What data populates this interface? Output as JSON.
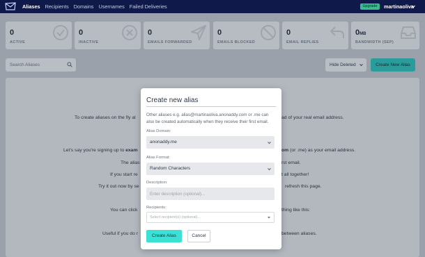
{
  "nav": {
    "links": [
      "Aliases",
      "Recipients",
      "Domains",
      "Usernames",
      "Failed Deliveries"
    ],
    "active_index": 0,
    "upgrade_label": "Upgrade",
    "username": "martinaoliva"
  },
  "stats": [
    {
      "value": "0",
      "unit": "",
      "label": "Active",
      "icon": "check-circle-icon"
    },
    {
      "value": "0",
      "unit": "",
      "label": "Inactive",
      "icon": "x-circle-icon"
    },
    {
      "value": "0",
      "unit": "",
      "label": "Emails Forwarded",
      "icon": "send-icon"
    },
    {
      "value": "0",
      "unit": "",
      "label": "Emails Blocked",
      "icon": "block-icon"
    },
    {
      "value": "0",
      "unit": "",
      "label": "Email Replies",
      "icon": "reply-icon"
    },
    {
      "value": "0",
      "unit": "MB",
      "label": "Bandwidth (Sep)",
      "icon": "inbox-icon"
    }
  ],
  "toolbar": {
    "search_placeholder": "Search Aliases",
    "hide_deleted_label": "Hide Deleted",
    "new_alias_label": "Create New Alias"
  },
  "background": {
    "line1_left": "To create aliases on the fly al",
    "line1_right": "ad of your real email address.",
    "line2_left": "Let's say you're signing up to ",
    "line2_left_bold": "exam",
    "line2_right_bold": "om",
    "line2_right": " (or .me) as your email address.",
    "line3_left": "The alias",
    "line3_right": "rst email.",
    "line4_left": "If you start re",
    "line4_right": "t all together!",
    "line5_left": "Try it out now by se",
    "line5_right": "refresh this page.",
    "line6_left": "You can click",
    "line6_right": "thing like this:",
    "line7_left": "Useful if you do r",
    "line7_right": "between aliases."
  },
  "modal": {
    "title": "Create new alias",
    "description": "Other aliases e.g. alias@martinaoliva.anonaddy.com or .me can also be created automatically when they receive their first email.",
    "domain_label": "Alias Domain:",
    "domain_value": "anonaddy.me",
    "format_label": "Alias Format:",
    "format_value": "Random Characters",
    "description_label": "Description:",
    "description_placeholder": "Enter description (optional)...",
    "recipients_label": "Recipients:",
    "recipients_placeholder": "Select recipient(s) (optional)...",
    "create_label": "Create Alias",
    "cancel_label": "Cancel"
  },
  "colors": {
    "nav_bg": "#0f1a4a",
    "accent": "#3ce1d6",
    "overlay": "#9aa1ab"
  }
}
